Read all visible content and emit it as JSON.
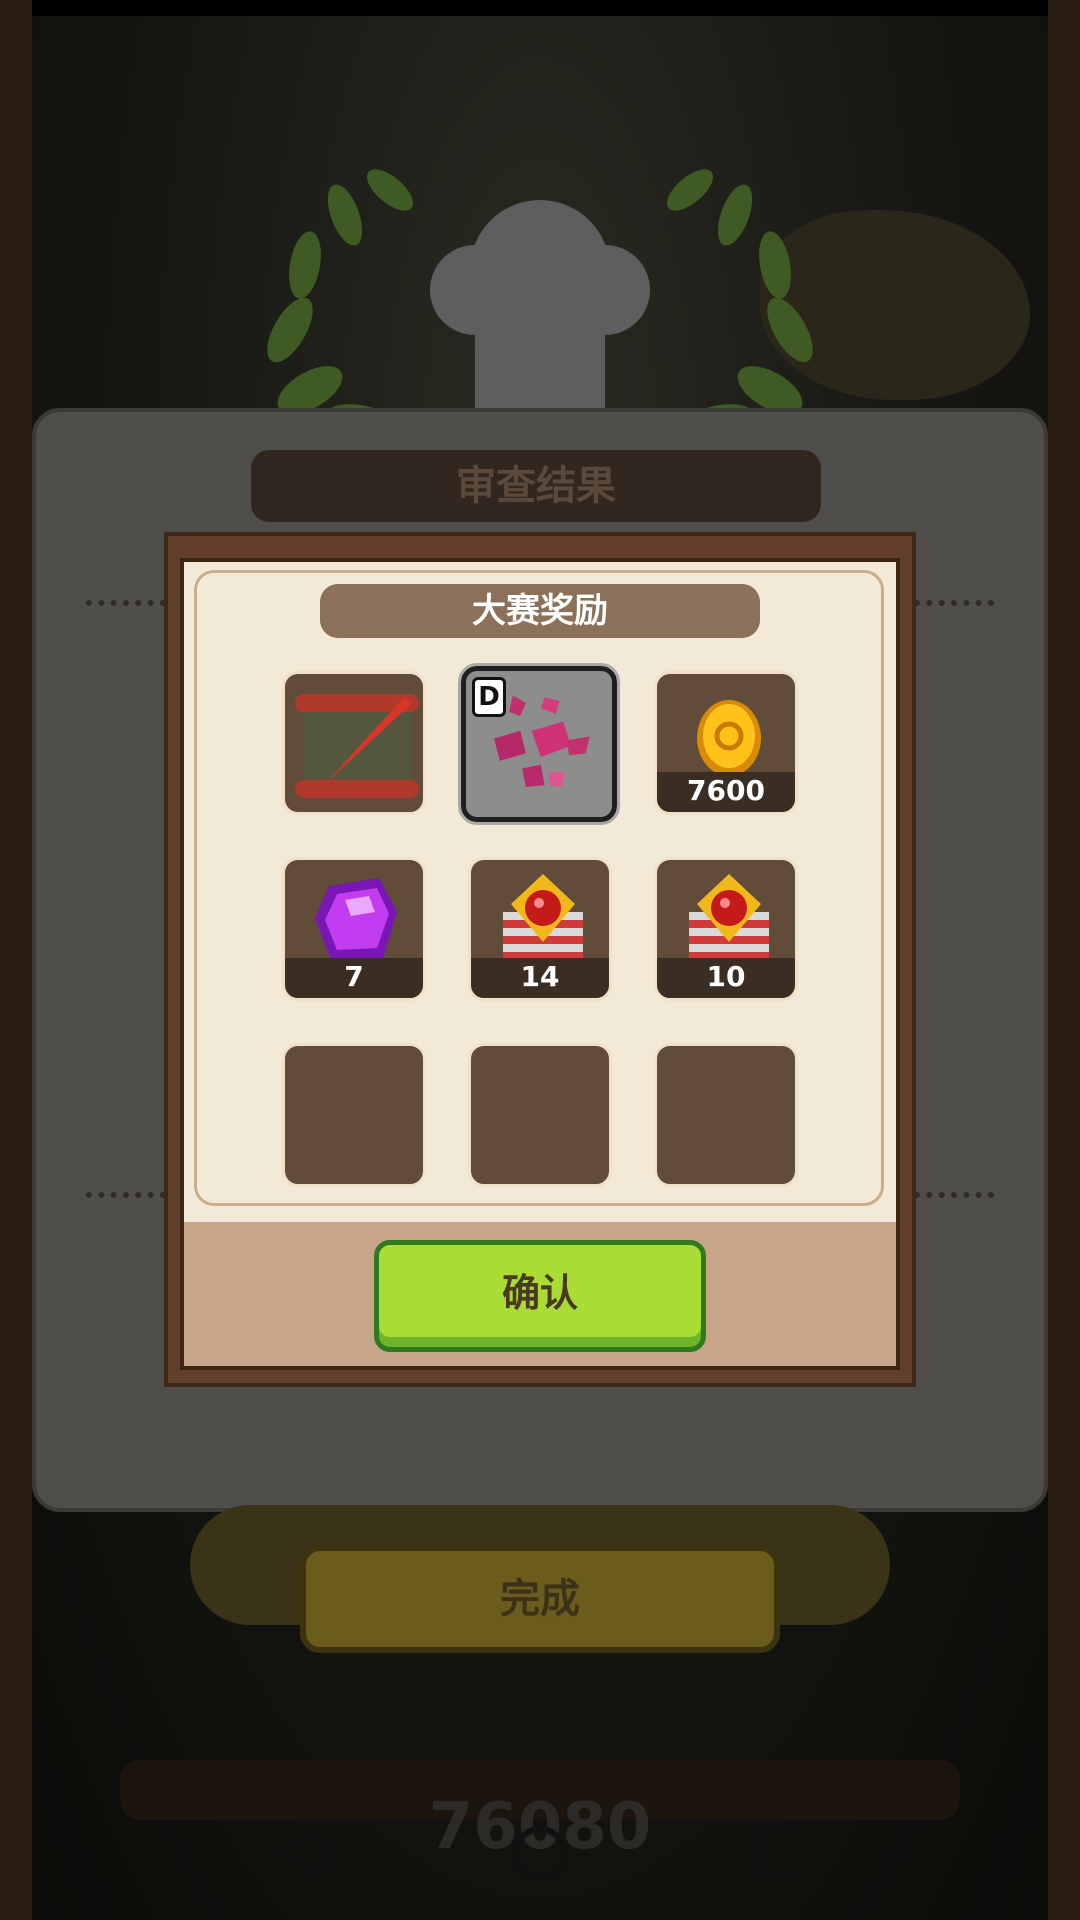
{
  "background": {
    "panel_title": "审查结果",
    "done_label": "完成",
    "score": "76080"
  },
  "dialog": {
    "section_title": "大赛奖励",
    "rewards": [
      {
        "name": "scroll-quill-icon",
        "count": ""
      },
      {
        "name": "pink-crystal-shards-icon",
        "count": "",
        "grade": "D",
        "selected": true
      },
      {
        "name": "gold-coin-icon",
        "count": "7600"
      },
      {
        "name": "purple-gem-icon",
        "count": "7"
      },
      {
        "name": "medal-icon",
        "count": "14"
      },
      {
        "name": "medal-icon",
        "count": "10"
      },
      {
        "name": "empty-slot",
        "count": ""
      },
      {
        "name": "empty-slot",
        "count": ""
      },
      {
        "name": "empty-slot",
        "count": ""
      }
    ],
    "confirm_label": "确认"
  },
  "nav": {
    "back": "back-icon",
    "home": "home-icon",
    "recents": "recents-icon"
  }
}
